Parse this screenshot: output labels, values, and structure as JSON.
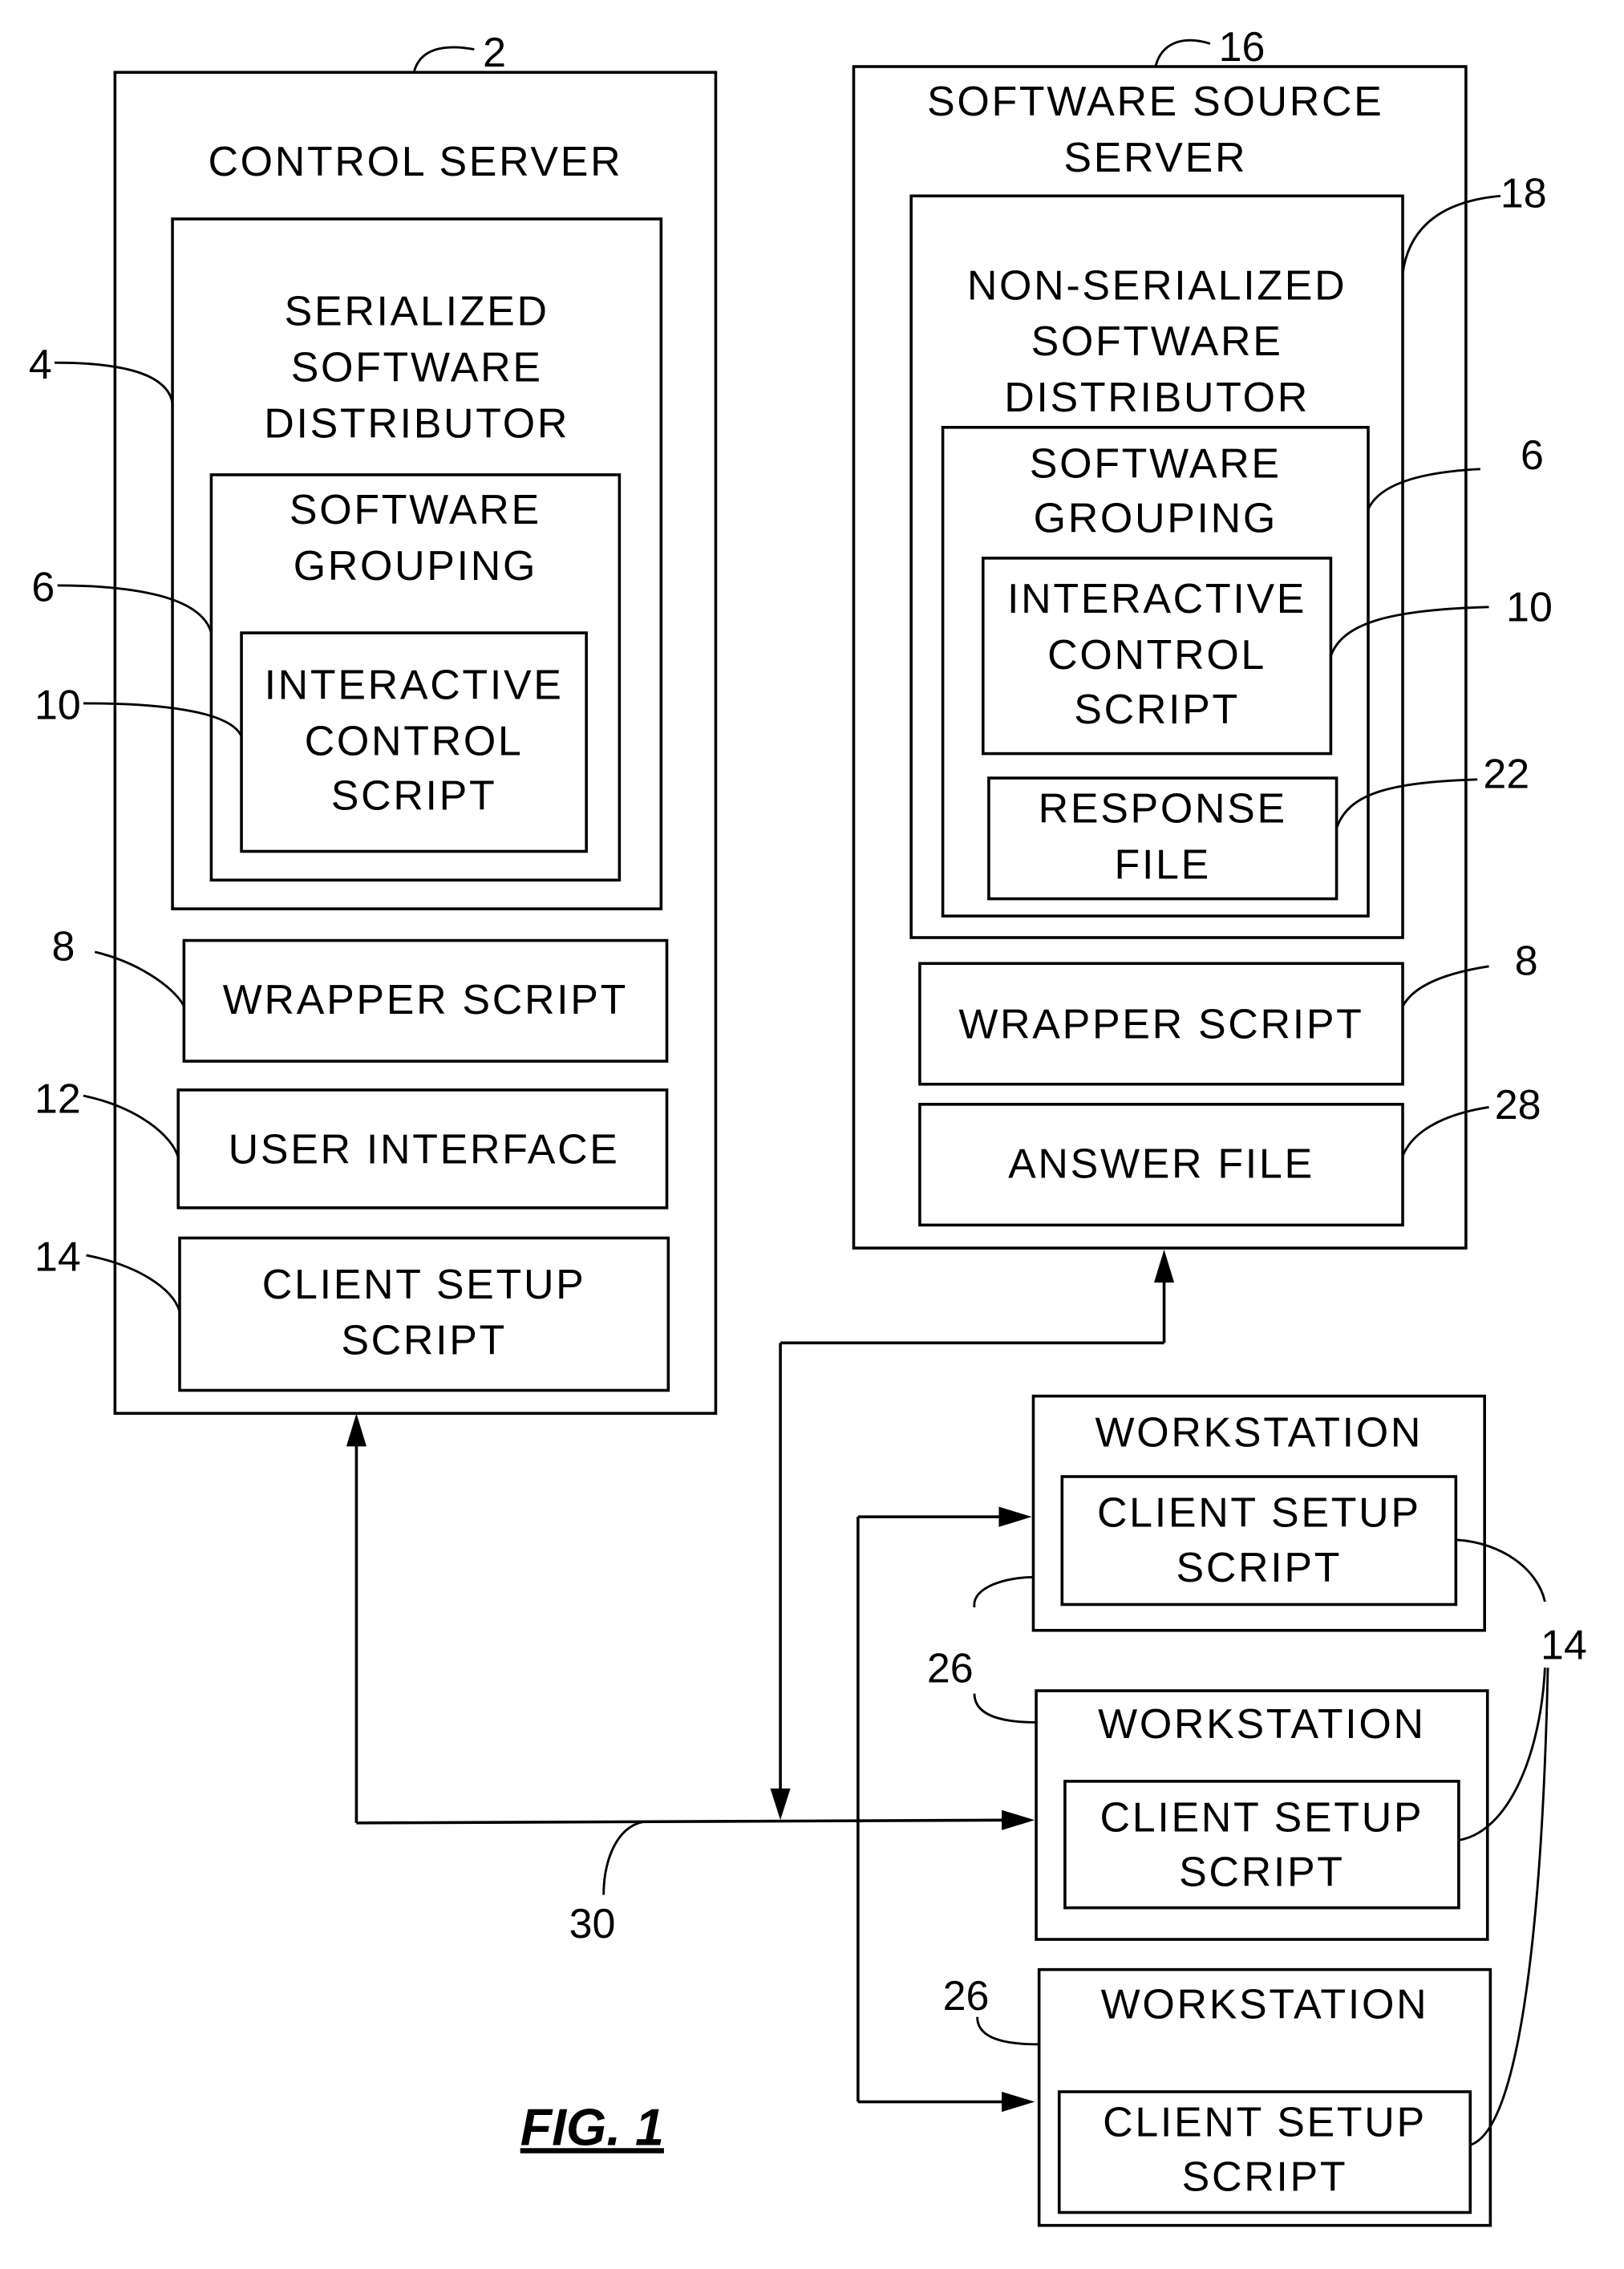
{
  "figure": {
    "label": "FIG. 1"
  },
  "control_server": {
    "ref": "2",
    "title": "CONTROL SERVER",
    "distributor": {
      "ref": "4",
      "lines": [
        "SERIALIZED",
        "SOFTWARE",
        "DISTRIBUTOR"
      ],
      "grouping": {
        "ref": "6",
        "lines": [
          "SOFTWARE",
          "GROUPING"
        ],
        "script": {
          "ref": "10",
          "lines": [
            "INTERACTIVE",
            "CONTROL",
            "SCRIPT"
          ]
        }
      }
    },
    "wrapper": {
      "ref": "8",
      "label": "WRAPPER SCRIPT"
    },
    "user_interface": {
      "ref": "12",
      "label": "USER INTERFACE"
    },
    "client_setup": {
      "ref": "14",
      "lines": [
        "CLIENT SETUP",
        "SCRIPT"
      ]
    }
  },
  "source_server": {
    "ref": "16",
    "title_lines": [
      "SOFTWARE SOURCE",
      "SERVER"
    ],
    "distributor": {
      "ref": "18",
      "lines": [
        "NON-SERIALIZED",
        "SOFTWARE",
        "DISTRIBUTOR"
      ],
      "grouping": {
        "ref": "6",
        "lines": [
          "SOFTWARE",
          "GROUPING"
        ],
        "script": {
          "ref": "10",
          "lines": [
            "INTERACTIVE",
            "CONTROL",
            "SCRIPT"
          ]
        },
        "response": {
          "ref": "22",
          "lines": [
            "RESPONSE",
            "FILE"
          ]
        }
      }
    },
    "wrapper": {
      "ref": "8",
      "label": "WRAPPER SCRIPT"
    },
    "answer": {
      "ref": "28",
      "label": "ANSWER FILE"
    }
  },
  "network": {
    "ref": "30"
  },
  "workstations": {
    "ref_workstation": "26",
    "ref_client_setup": "14",
    "items": [
      {
        "title": "WORKSTATION",
        "script_lines": [
          "CLIENT SETUP",
          "SCRIPT"
        ]
      },
      {
        "title": "WORKSTATION",
        "script_lines": [
          "CLIENT SETUP",
          "SCRIPT"
        ]
      },
      {
        "title": "WORKSTATION",
        "script_lines": [
          "CLIENT SETUP",
          "SCRIPT"
        ]
      }
    ]
  }
}
